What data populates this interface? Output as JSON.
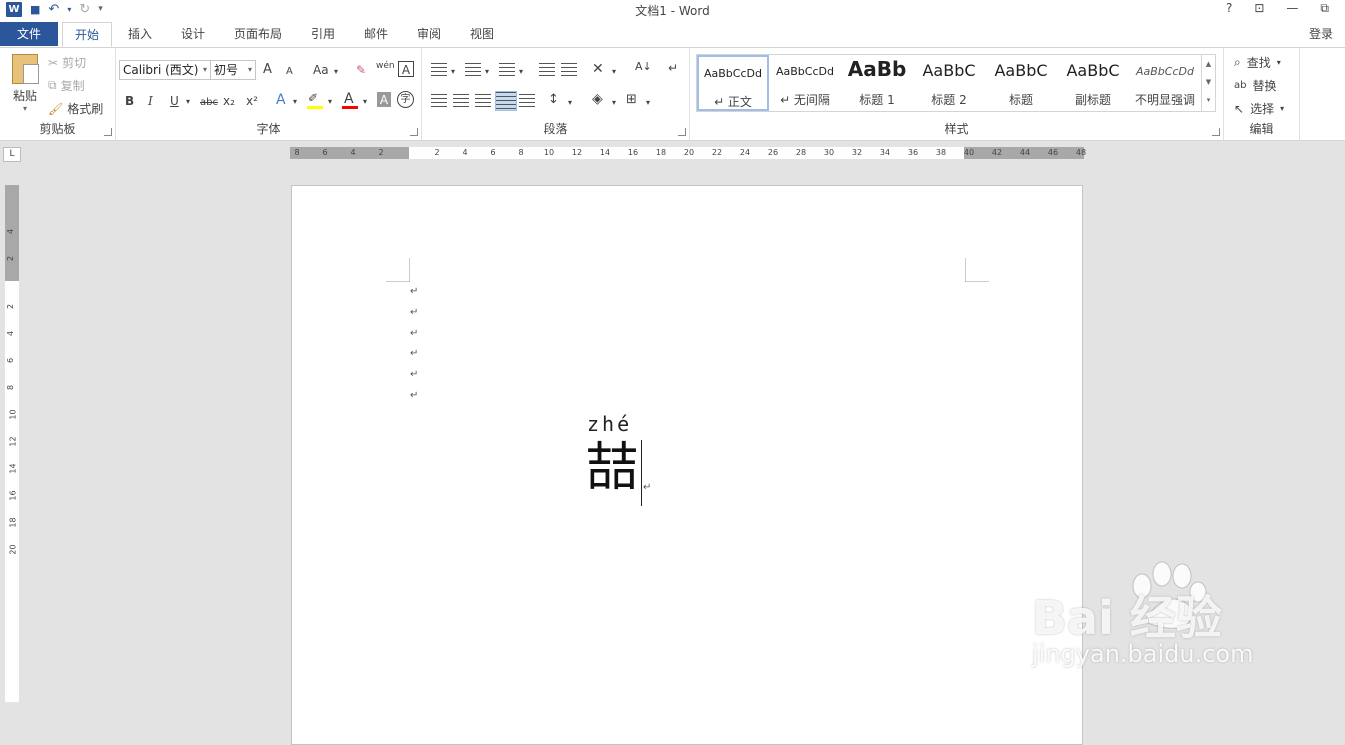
{
  "window": {
    "title": "文档1 - Word",
    "help": "?",
    "restore": "⊡",
    "minimize": "—",
    "maximize": "⧉"
  },
  "qat": {
    "logo": "W",
    "save_icon": "💾",
    "undo_icon": "↶",
    "redo_icon": "↻",
    "customize_icon": "▾"
  },
  "tabs": {
    "file": "文件",
    "items": [
      "开始",
      "插入",
      "设计",
      "页面布局",
      "引用",
      "邮件",
      "审阅",
      "视图"
    ],
    "active": "开始",
    "login": "登录"
  },
  "clipboard": {
    "paste": "粘贴",
    "cut": "剪切",
    "copy": "复制",
    "format_painter": "格式刷",
    "label": "剪贴板"
  },
  "font": {
    "name": "Calibri (西文)",
    "size": "初号",
    "grow": "A",
    "shrink": "A",
    "case": "Aa",
    "bold": "B",
    "italic": "I",
    "underline": "U",
    "strike": "abc",
    "subscript": "x₂",
    "superscript": "x²",
    "phonetic": "wén",
    "label": "字体",
    "highlight_color": "#ffff00",
    "font_color": "#ff0000"
  },
  "paragraph": {
    "label": "段落"
  },
  "styles": {
    "label": "样式",
    "items": [
      {
        "preview": "AaBbCcDd",
        "name": "↵ 正文"
      },
      {
        "preview": "AaBbCcDd",
        "name": "↵ 无间隔"
      },
      {
        "preview": "AaBb",
        "name": "标题 1"
      },
      {
        "preview": "AaBbC",
        "name": "标题 2"
      },
      {
        "preview": "AaBbC",
        "name": "标题"
      },
      {
        "preview": "AaBbC",
        "name": "副标题"
      },
      {
        "preview": "AaBbCcDd",
        "name": "不明显强调"
      }
    ]
  },
  "editing": {
    "find": "查找",
    "replace": "替换",
    "select": "选择",
    "label": "编辑"
  },
  "ruler": {
    "tab_selector": "L",
    "h_left": [
      "8",
      "6",
      "4",
      "2"
    ],
    "h_right": [
      "2",
      "4",
      "6",
      "8",
      "10",
      "12",
      "14",
      "16",
      "18",
      "20",
      "22",
      "24",
      "26",
      "28",
      "30",
      "32",
      "34",
      "36",
      "38",
      "40",
      "42",
      "44",
      "46",
      "48"
    ],
    "v_top": [
      "4",
      "2"
    ],
    "v_main": [
      "2",
      "4",
      "6",
      "8",
      "10",
      "12",
      "14",
      "16",
      "18",
      "20"
    ]
  },
  "document": {
    "para_mark": "↵",
    "pinyin": "zhé",
    "hanzi": "喆",
    "end_mark": "↵"
  },
  "watermark": {
    "brand": "Bai  经验",
    "url": "jingyan.baidu.com"
  }
}
